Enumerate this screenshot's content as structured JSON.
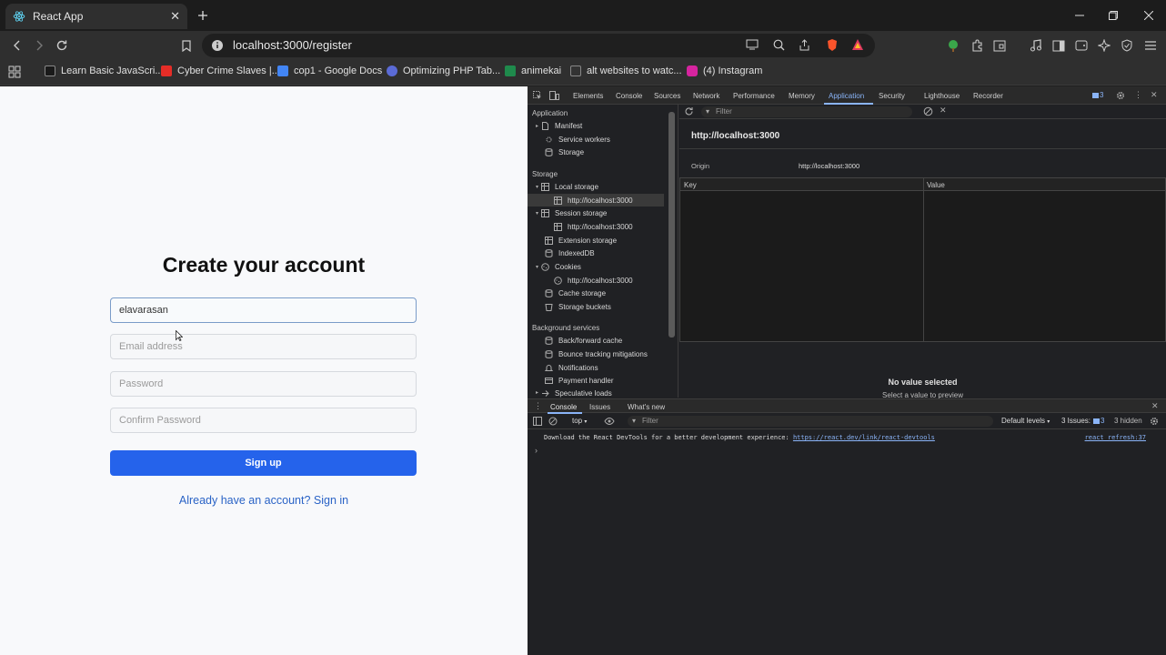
{
  "browser": {
    "tab_title": "React App",
    "url": "localhost:3000/register",
    "bookmarks": [
      {
        "label": "Learn Basic JavaScri...",
        "color": "#1a1a1a"
      },
      {
        "label": "Cyber Crime Slaves |...",
        "color": "#e52d27"
      },
      {
        "label": "cop1 - Google Docs",
        "color": "#4285f4"
      },
      {
        "label": "Optimizing PHP Tab...",
        "color": "#5b6bd6"
      },
      {
        "label": "animekai",
        "color": "#1f8a4c"
      },
      {
        "label": "alt websites to watc...",
        "color": "#333333"
      },
      {
        "label": "(4) Instagram",
        "color": "#d6249f"
      }
    ]
  },
  "form": {
    "title": "Create your account",
    "username_value": "elavarasan",
    "email_placeholder": "Email address",
    "password_placeholder": "Password",
    "confirm_placeholder": "Confirm Password",
    "signup_label": "Sign up",
    "signin_link": "Already have an account? Sign in"
  },
  "devtools": {
    "tabs": [
      "Elements",
      "Console",
      "Sources",
      "Network",
      "Performance",
      "Memory",
      "Application",
      "Security",
      "Lighthouse",
      "Recorder"
    ],
    "active_tab": "Application",
    "issues_badge": "3",
    "sidebar": {
      "application_header": "Application",
      "application_items": [
        "Manifest",
        "Service workers",
        "Storage"
      ],
      "storage_header": "Storage",
      "local_storage": "Local storage",
      "local_origin": "http://localhost:3000",
      "session_storage": "Session storage",
      "session_origin": "http://localhost:3000",
      "extension_storage": "Extension storage",
      "indexeddb": "IndexedDB",
      "cookies": "Cookies",
      "cookies_origin": "http://localhost:3000",
      "cache_storage": "Cache storage",
      "storage_buckets": "Storage buckets",
      "background_header": "Background services",
      "background_items": [
        "Back/forward cache",
        "Bounce tracking mitigations",
        "Notifications",
        "Payment handler",
        "Speculative loads"
      ]
    },
    "main": {
      "filter_placeholder": "Filter",
      "origin_title": "http://localhost:3000",
      "origin_label": "Origin",
      "origin_value": "http://localhost:3000",
      "col_key": "Key",
      "col_value": "Value",
      "empty_title": "No value selected",
      "empty_sub": "Select a value to preview"
    },
    "drawer": {
      "tabs": [
        "Console",
        "Issues",
        "What's new"
      ],
      "context": "top",
      "filter_placeholder": "Filter",
      "levels": "Default levels",
      "issues_label": "3 Issues:",
      "issues_count": "3",
      "hidden": "3 hidden",
      "message_text": "Download the React DevTools for a better development experience: ",
      "message_link": "https://react.dev/link/react-devtools",
      "message_source": "react refresh:37",
      "prompt": "›"
    }
  }
}
